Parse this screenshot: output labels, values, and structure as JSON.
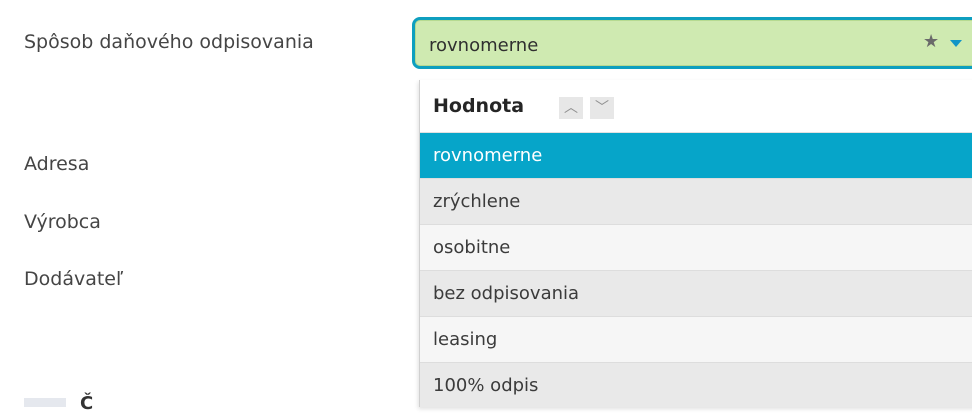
{
  "form": {
    "depreciation_method_label": "Spôsob daňového odpisovania",
    "address_label": "Adresa",
    "manufacturer_label": "Výrobca",
    "supplier_label": "Dodávateľ",
    "partial_bottom_text": "Č"
  },
  "select": {
    "current_value": "rovnomerne",
    "favorite_icon": "star-icon",
    "expand_icon": "caret-down-icon",
    "border_color": "#0e9fbf",
    "background_color": "#cfeab1"
  },
  "dropdown": {
    "column_header": "Hodnota",
    "sort_up_icon": "chevron-up-icon",
    "sort_down_icon": "chevron-down-icon",
    "selected_color": "#06a5c9",
    "options": [
      {
        "label": "rovnomerne",
        "selected": true
      },
      {
        "label": "zrýchlene",
        "selected": false
      },
      {
        "label": "osobitne",
        "selected": false
      },
      {
        "label": "bez odpisovania",
        "selected": false
      },
      {
        "label": "leasing",
        "selected": false
      },
      {
        "label": "100% odpis",
        "selected": false
      }
    ]
  }
}
